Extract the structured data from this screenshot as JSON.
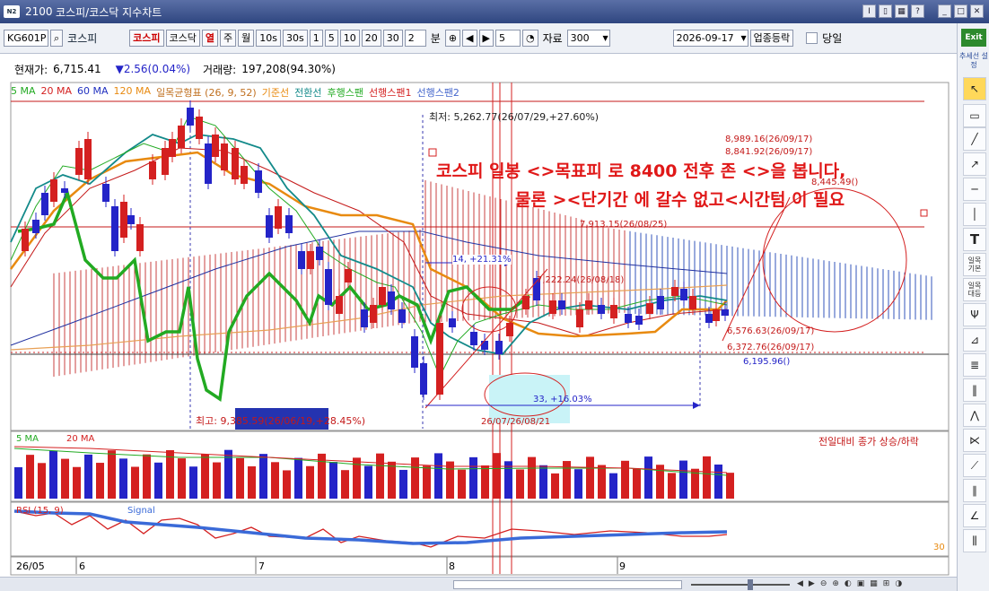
{
  "window": {
    "code": "2100",
    "title": "코스피/코스닥 지수차트",
    "logo": "N2"
  },
  "toolbar": {
    "code": "KG601P",
    "name": "코스피",
    "market1": "코스피",
    "market2": "코스닥",
    "periods": [
      "열",
      "주",
      "월",
      "10s",
      "30s",
      "1",
      "5",
      "10",
      "20",
      "30"
    ],
    "period_value": "2",
    "period_unit": "분",
    "step_value": "5",
    "data_label": "자료",
    "data_count": "300",
    "date": "2026-09-17",
    "sector_button": "업종등락",
    "today_label": "당일"
  },
  "info": {
    "price_label": "현재가:",
    "price": "6,715.41",
    "change": "▼2.56(0.04%)",
    "volume_label": "거래량:",
    "volume": "197,208(94.30%)"
  },
  "legend": [
    {
      "label": "5 MA",
      "color": "#22aa22"
    },
    {
      "label": "20 MA",
      "color": "#d42020"
    },
    {
      "label": "60 MA",
      "color": "#2030c0"
    },
    {
      "label": "120 MA",
      "color": "#e88a10"
    },
    {
      "label": "일목균형표 (26, 9, 52)",
      "color": "#e88a10"
    },
    {
      "label": "기준선",
      "color": "#e88a10"
    },
    {
      "label": "전환선",
      "color": "#138a8a"
    },
    {
      "label": "후행스팬",
      "color": "#22aa22"
    },
    {
      "label": "선행스팬1",
      "color": "#d42020"
    },
    {
      "label": "선행스팬2",
      "color": "#4466cc"
    }
  ],
  "annotations": {
    "line1": "코스피 일봉 <>목표피 로 8400 전후 존 <>을 봅니다,",
    "line2": "물론 ><단기간 에 갈수 없고<시간텀 이 필요",
    "high": "최고: 9,385.59(26/06/19,+28.45%)",
    "low": "최저: 5,262.77(26/07/29,+27.60%)",
    "p1": "8,989.16(26/09/17)",
    "p2": "8,841.92(26/09/17)",
    "p3": "8,445.49()",
    "p4": "7,913.15(26/08/25)",
    "p5": "7,222.24(26/08/18)",
    "p6": "6,576.63(26/09/17)",
    "p7": "6,372.76(26/09/17)",
    "p8": "6,195.96()",
    "p9": "14, +21.31%",
    "p10": "33, +16.03%",
    "p11": "26/07/26/08/21"
  },
  "volume_panel": {
    "legend5": "5 MA",
    "legend20": "20 MA",
    "right_label": "전일대비 종가 상승/하락"
  },
  "rsi_panel": {
    "legend": "RSI (15, 9)",
    "rsi": "RSI",
    "signal": "Signal",
    "level": "30"
  },
  "xaxis": [
    "26/05",
    "6",
    "7",
    "8",
    "9"
  ],
  "rightbar": {
    "exit": "Exit",
    "trend": "추세선 설정",
    "ilmok1": "일목 기본",
    "ilmok2": "일목 대등"
  },
  "colors": {
    "up": "#d42020",
    "down": "#2424c8",
    "accent": "#2f4680"
  }
}
